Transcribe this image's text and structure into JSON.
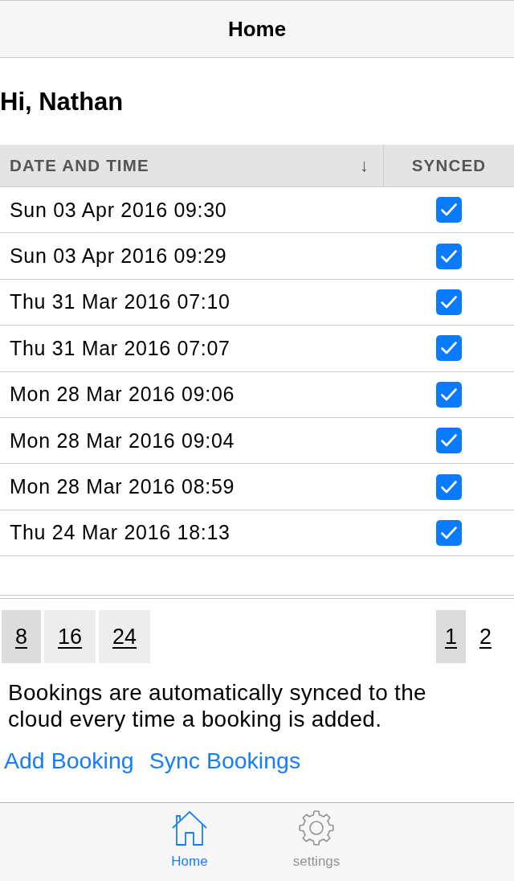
{
  "nav_bar": {
    "title": "Home"
  },
  "greeting": "Hi, Nathan",
  "table": {
    "columns": [
      {
        "label": "DATE AND TIME",
        "sort_indicator": "↓"
      },
      {
        "label": "SYNCED"
      }
    ],
    "rows": [
      {
        "date_time": "Sun 03 Apr 2016 09:30",
        "synced": true
      },
      {
        "date_time": "Sun 03 Apr 2016 09:29",
        "synced": true
      },
      {
        "date_time": "Thu 31 Mar 2016 07:10",
        "synced": true
      },
      {
        "date_time": "Thu 31 Mar 2016 07:07",
        "synced": true
      },
      {
        "date_time": "Mon 28 Mar 2016 09:06",
        "synced": true
      },
      {
        "date_time": "Mon 28 Mar 2016 09:04",
        "synced": true
      },
      {
        "date_time": "Mon 28 Mar 2016 08:59",
        "synced": true
      },
      {
        "date_time": "Thu 24 Mar 2016 18:13",
        "synced": true
      }
    ]
  },
  "pagination": {
    "page_sizes": [
      {
        "label": "8",
        "selected": true
      },
      {
        "label": "16",
        "selected": false
      },
      {
        "label": "24",
        "selected": false
      }
    ],
    "pages": [
      {
        "label": "1",
        "selected": true
      },
      {
        "label": "2",
        "selected": false
      }
    ]
  },
  "note": "Bookings are automatically synced to the cloud every time a booking is added.",
  "actions": [
    {
      "label": "Add Booking"
    },
    {
      "label": "Sync Bookings"
    }
  ],
  "tab_bar": {
    "tabs": [
      {
        "label": "Home",
        "kind": "home",
        "selected": true
      },
      {
        "label": "settings",
        "kind": "settings",
        "selected": false
      }
    ]
  }
}
